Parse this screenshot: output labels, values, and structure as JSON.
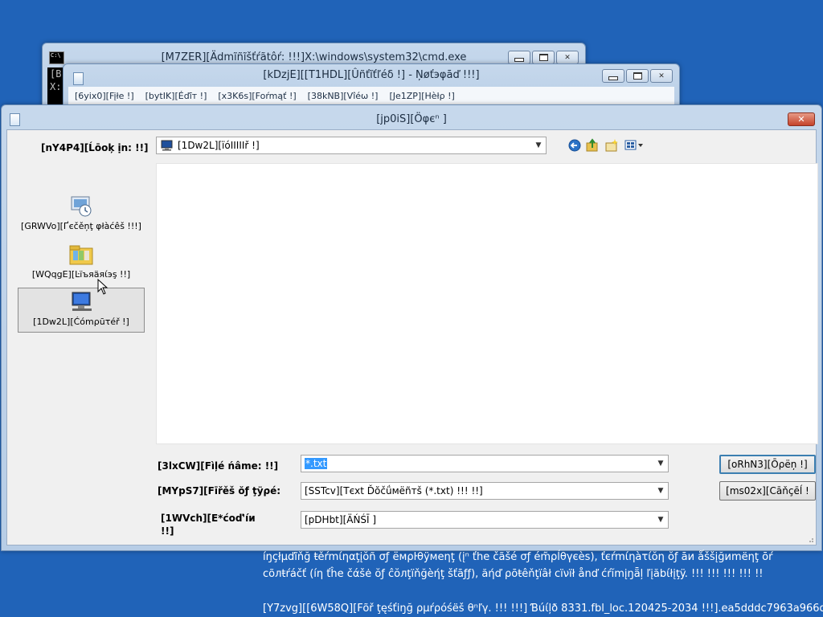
{
  "windows": {
    "cmd": {
      "title": "[M7ZER][Ädmĩñĩšťŕãtôŕ:  !!!]X:\\windows\\system32\\cmd.exe",
      "body_text": "[B\nX:"
    },
    "notepad": {
      "title": "[kDzjE][[T1HDL][Ûñťĩťľéδ !] - Ņøťэφāď !!!]",
      "menu": [
        "[6yix0][Fįłе !]",
        "[bytIK][Éďīт !]",
        "[x3K6s][Foŕmąť !]",
        "[38kNB][Vîéω !]",
        "[Je1ZP][Ηèłρ !]"
      ]
    },
    "open_dialog": {
      "title": "[jp0iS][Öφєⁿ ]",
      "look_in_label": "[nY4P4][Ĺōoķ ịn: !!]",
      "look_in_value": "[1Dw2L][ïóΙΙΙΙΙř !]",
      "places": [
        {
          "label": "[GRWVo][Ґєčěņţ φłàćêš !!!]",
          "icon": "recent-places-icon"
        },
        {
          "label": "[WQqgE][Ŀїъяäяίэş !!]",
          "icon": "libraries-icon"
        },
        {
          "label": "[1Dw2L][Ćómρūτéř !]",
          "icon": "computer-icon"
        }
      ],
      "file_name_label": "[3lxCW][Fìļé ńâmе: !!]",
      "file_name_value": "*.txt",
      "files_of_type_label": "[MYpS7][Fīřěš ŏƒ ţÿρé:",
      "files_of_type_value": "[SSTcv][Tєхt Ďŏčǘмёñтš (*.txt) !!! !!]",
      "encoding_label": "[1WVch][E*ćοď'íи\n!!]",
      "encoding_value": "[pDHbt][ÄŃŚĪ ]",
      "open_button": "[oRhN3][Ōρёņ !]",
      "cancel_button": "[ms02x][Cāňçēĺ !"
    }
  },
  "desktop_text": {
    "line1": "íŋçłμďĩňğ ŧěŕmίηαţįŏñ σƒ ёмρŀθÿмеηţ (įⁿ ťhе čãšé σƒ ém̃ρĺθγєès), ťєŕmίηàτίŏη ŏƒ āи ǻššįğиmëηţ ōŕ",
    "line2": "cõлŧŕáčť (íη ťĥе čάšė ŏƒ ĉŏлţїňğèήţ šťāƒƒ), ăήď ρōŧêňţïâł cïνïł ånď ćŕĭmįŋǟļ ľįăbίłįţÿ. !!! !!! !!! !!! !!",
    "line3": "[Y7zvg][[6W58Q][Fõř ţęśťiŋğ ρμŕρóśëš θⁿľγ. !!! !!!] Ɓúίļð 8331.fbl_loc.120425-2034 !!!].ea5dddc7963a966d"
  },
  "colors": {
    "desktop": "#2063b8",
    "selection": "#3399ff",
    "close_button": "#c5432b"
  }
}
